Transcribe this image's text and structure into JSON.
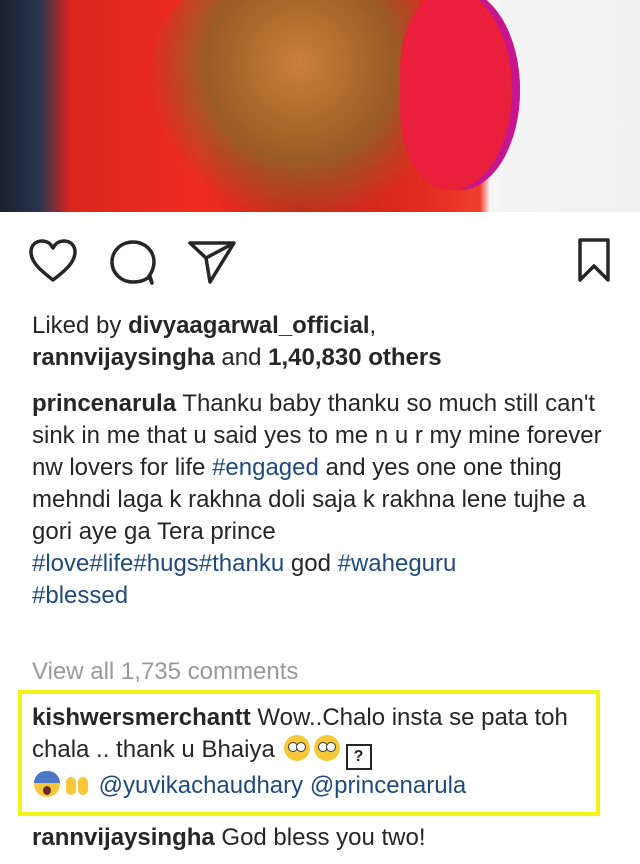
{
  "post": {
    "likes": {
      "prefix": "Liked by ",
      "user1": "divyaagarwal_official",
      "sep": ",",
      "user2": "rannvijaysingha",
      "and": " and ",
      "others": "1,40,830 others"
    },
    "caption": {
      "author": "princenarula",
      "text1": " Thanku baby thanku so much still can't sink in me that u said yes to me n u r my mine forever nw  lovers for life ",
      "tag1": "#engaged",
      "text2": " and yes one one thing mehndi laga k rakhna doli saja k rakhna lene tujhe a gori aye ga Tera prince ",
      "tags2": "#love#life#hugs#thanku",
      "text3": " god ",
      "tag3": "#waheguru",
      "tag4": "#blessed"
    },
    "view_comments": "View all 1,735 comments",
    "comments": [
      {
        "author": "kishwersmerchantt",
        "text": " Wow..Chalo insta se pata toh chala .. thank u Bhaiya ",
        "box_glyph": "?",
        "mention1": "@yuvikachaudhary",
        "mention2": "@princenarula"
      },
      {
        "author": "rannvijaysingha",
        "text": " God bless you two!"
      }
    ]
  },
  "icons": [
    "heart-icon",
    "comment-icon",
    "share-icon",
    "bookmark-icon"
  ],
  "colors": {
    "link": "#1f4a7c",
    "muted": "#999999",
    "highlight": "#f2f21b"
  }
}
